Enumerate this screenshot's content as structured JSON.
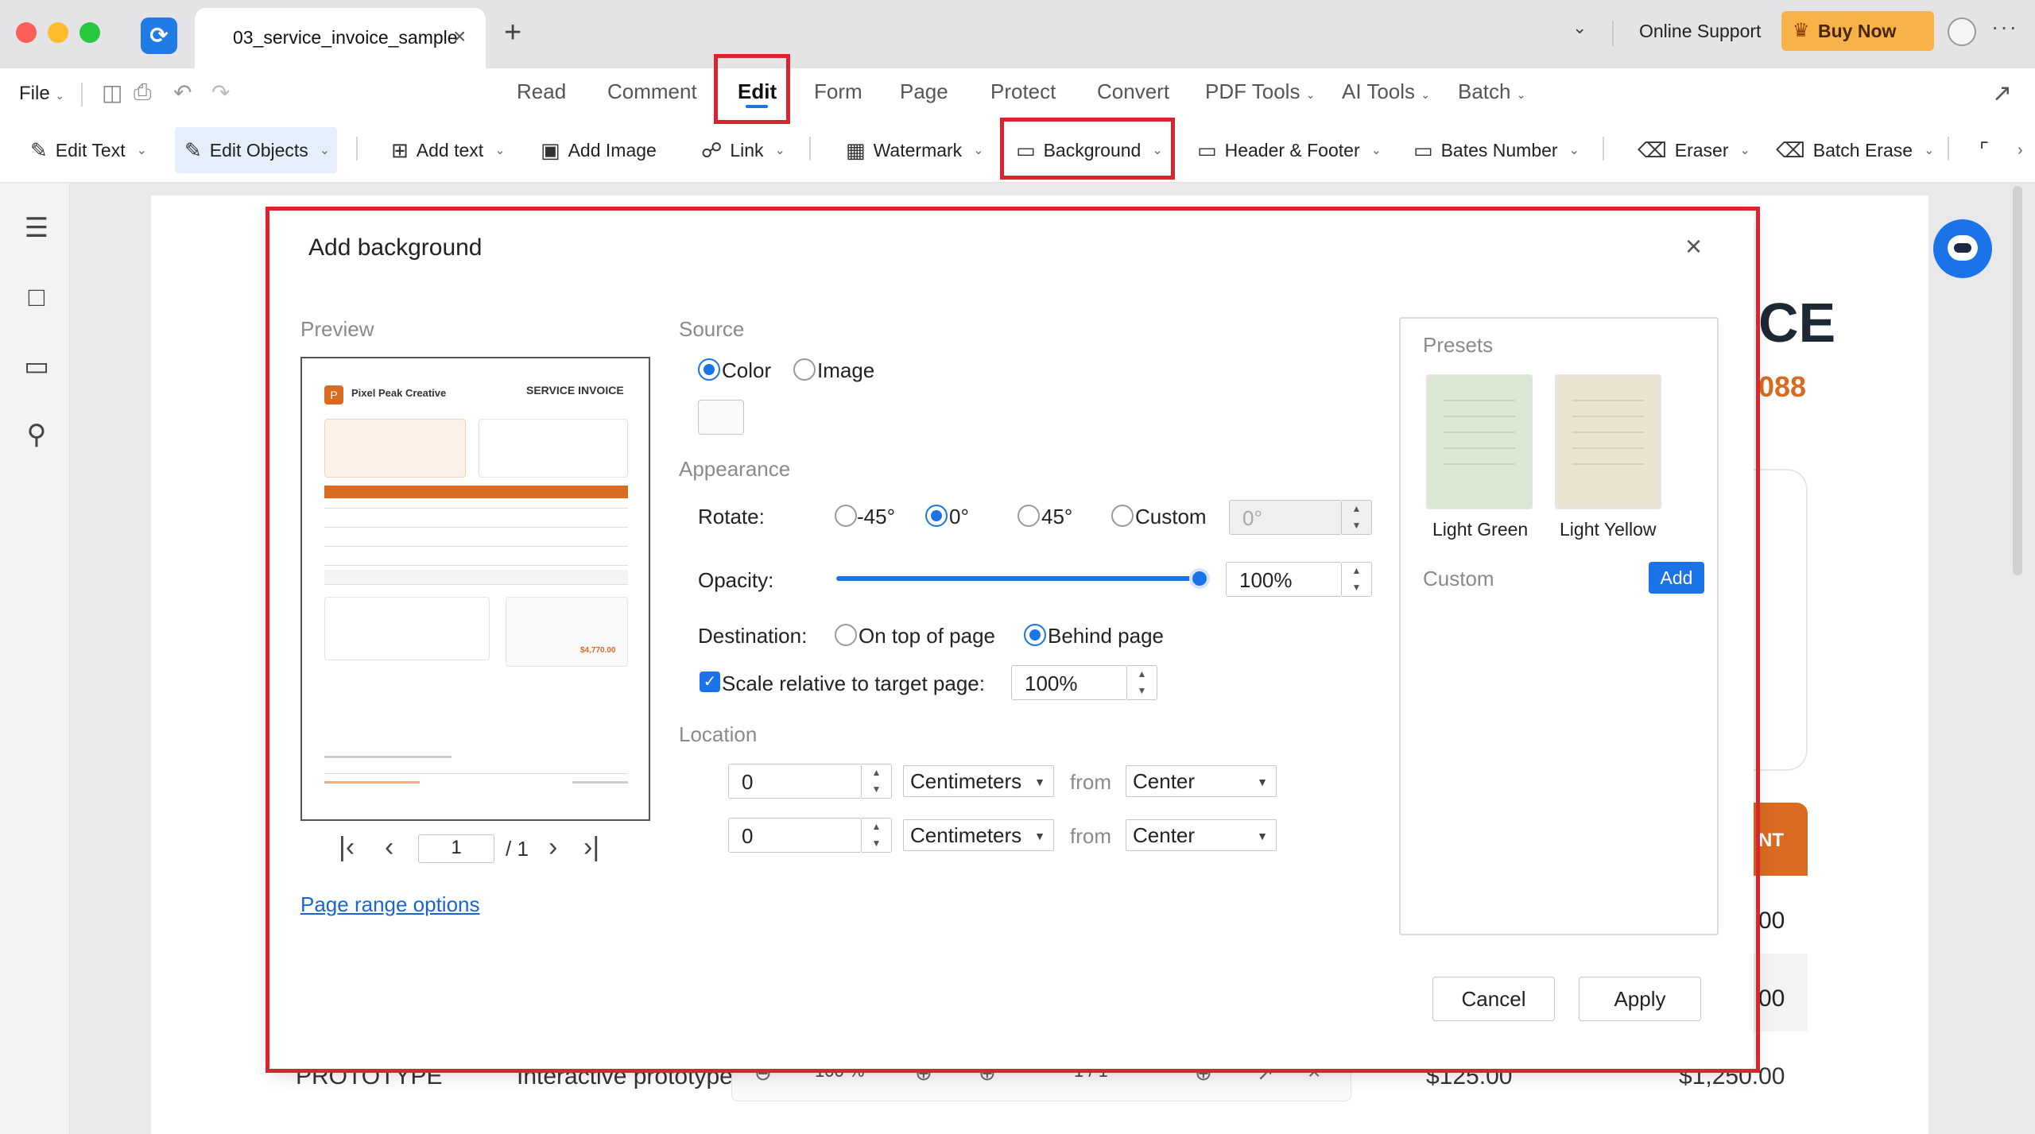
{
  "titlebar": {
    "doc_tab_label": "03_service_invoice_sample",
    "online_support": "Online Support",
    "buy_now": "Buy Now"
  },
  "menubar": {
    "file": "File",
    "tabs": [
      "Read",
      "Comment",
      "Edit",
      "Form",
      "Page",
      "Protect",
      "Convert",
      "PDF Tools",
      "AI Tools",
      "Batch"
    ]
  },
  "toolbar": {
    "edit_text": "Edit Text",
    "edit_objects": "Edit Objects",
    "add_text": "Add text",
    "add_image": "Add Image",
    "link": "Link",
    "watermark": "Watermark",
    "background": "Background",
    "header_footer": "Header & Footer",
    "bates_number": "Bates Number",
    "eraser": "Eraser",
    "batch_erase": "Batch Erase"
  },
  "document_bg": {
    "title_fragment": "CE",
    "number_fragment": "088",
    "col_fragment": "NT",
    "row_fragment_1": "00",
    "row_fragment_2": "00",
    "bottom_row": {
      "item": "PROTOTYPE",
      "desc": "Interactive prototype",
      "rate": "$125.00",
      "amount": "$1,250.00"
    },
    "bottom_toolbar": {
      "zoom": "100 %",
      "page": "1 / 1"
    }
  },
  "dialog": {
    "title": "Add background",
    "preview_label": "Preview",
    "preview_doc": {
      "company": "Pixel Peak Creative",
      "doc_title": "SERVICE INVOICE",
      "total": "$4,770.00"
    },
    "pager": {
      "current": "1",
      "total": "/ 1"
    },
    "page_range_link": "Page range options",
    "source": {
      "label": "Source",
      "color": "Color",
      "image": "Image"
    },
    "appearance": {
      "label": "Appearance",
      "rotate_label": "Rotate:",
      "rotate_options": [
        "-45°",
        "0°",
        "45°",
        "Custom"
      ],
      "rotate_custom_value": "0°",
      "opacity_label": "Opacity:",
      "opacity_value": "100%",
      "opacity_fraction": 1.0,
      "destination_label": "Destination:",
      "destination_options": [
        "On top of page",
        "Behind page"
      ],
      "scale_label": "Scale relative to target page:",
      "scale_value": "100%"
    },
    "location": {
      "label": "Location",
      "row1_value": "0",
      "row1_unit": "Centimeters",
      "row1_from": "from",
      "row1_anchor": "Center",
      "row2_value": "0",
      "row2_unit": "Centimeters",
      "row2_from": "from",
      "row2_anchor": "Center"
    },
    "presets": {
      "label": "Presets",
      "items": [
        "Light Green",
        "Light Yellow"
      ],
      "custom_label": "Custom",
      "add_button": "Add"
    },
    "cancel": "Cancel",
    "apply": "Apply"
  },
  "colors": {
    "accent": "#1a73e8",
    "highlight": "#d9252d",
    "buy_now_bg": "#f7b24a",
    "invoice_orange": "#d96a1f",
    "preset_green": "#dbe8d3",
    "preset_yellow": "#ebe4d2"
  }
}
